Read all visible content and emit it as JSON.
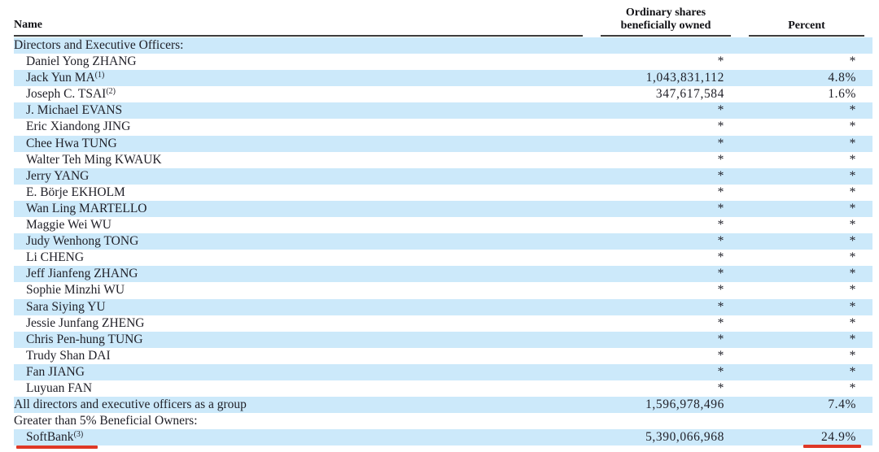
{
  "table": {
    "columns": {
      "name": "Name",
      "shares_line1": "Ordinary shares",
      "shares_line2": "beneficially owned",
      "percent": "Percent"
    },
    "rows": [
      {
        "name": "Directors and Executive Officers:",
        "footnote": "",
        "indent": 0,
        "shares": "",
        "percent": ""
      },
      {
        "name": "Daniel Yong ZHANG",
        "footnote": "",
        "indent": 1,
        "shares": "*",
        "percent": "*"
      },
      {
        "name": "Jack Yun MA",
        "footnote": "(1)",
        "indent": 1,
        "shares": "1,043,831,112",
        "percent": "4.8%"
      },
      {
        "name": "Joseph C. TSAI",
        "footnote": "(2)",
        "indent": 1,
        "shares": "347,617,584",
        "percent": "1.6%"
      },
      {
        "name": "J. Michael EVANS",
        "footnote": "",
        "indent": 1,
        "shares": "*",
        "percent": "*"
      },
      {
        "name": "Eric Xiandong JING",
        "footnote": "",
        "indent": 1,
        "shares": "*",
        "percent": "*"
      },
      {
        "name": "Chee Hwa TUNG",
        "footnote": "",
        "indent": 1,
        "shares": "*",
        "percent": "*"
      },
      {
        "name": "Walter Teh Ming KWAUK",
        "footnote": "",
        "indent": 1,
        "shares": "*",
        "percent": "*"
      },
      {
        "name": "Jerry YANG",
        "footnote": "",
        "indent": 1,
        "shares": "*",
        "percent": "*"
      },
      {
        "name": "E. Börje EKHOLM",
        "footnote": "",
        "indent": 1,
        "shares": "*",
        "percent": "*"
      },
      {
        "name": "Wan Ling MARTELLO",
        "footnote": "",
        "indent": 1,
        "shares": "*",
        "percent": "*"
      },
      {
        "name": "Maggie Wei WU",
        "footnote": "",
        "indent": 1,
        "shares": "*",
        "percent": "*"
      },
      {
        "name": "Judy Wenhong TONG",
        "footnote": "",
        "indent": 1,
        "shares": "*",
        "percent": "*"
      },
      {
        "name": "Li CHENG",
        "footnote": "",
        "indent": 1,
        "shares": "*",
        "percent": "*"
      },
      {
        "name": "Jeff Jianfeng ZHANG",
        "footnote": "",
        "indent": 1,
        "shares": "*",
        "percent": "*"
      },
      {
        "name": "Sophie Minzhi WU",
        "footnote": "",
        "indent": 1,
        "shares": "*",
        "percent": "*"
      },
      {
        "name": "Sara Siying YU",
        "footnote": "",
        "indent": 1,
        "shares": "*",
        "percent": "*"
      },
      {
        "name": "Jessie Junfang ZHENG",
        "footnote": "",
        "indent": 1,
        "shares": "*",
        "percent": "*"
      },
      {
        "name": "Chris Pen-hung TUNG",
        "footnote": "",
        "indent": 1,
        "shares": "*",
        "percent": "*"
      },
      {
        "name": "Trudy Shan DAI",
        "footnote": "",
        "indent": 1,
        "shares": "*",
        "percent": "*"
      },
      {
        "name": "Fan JIANG",
        "footnote": "",
        "indent": 1,
        "shares": "*",
        "percent": "*"
      },
      {
        "name": "Luyuan FAN",
        "footnote": "",
        "indent": 1,
        "shares": "*",
        "percent": "*"
      },
      {
        "name": "All directors and executive officers as a group",
        "footnote": "",
        "indent": 0,
        "shares": "1,596,978,496",
        "percent": "7.4%"
      },
      {
        "name": "Greater than 5% Beneficial Owners:",
        "footnote": "",
        "indent": 0,
        "shares": "",
        "percent": ""
      },
      {
        "name": "SoftBank",
        "footnote": "(3)",
        "indent": 1,
        "shares": "5,390,066,968",
        "percent": "24.9%"
      }
    ],
    "colors": {
      "row_highlight": "#cce9fa",
      "annotation_red": "#df3826"
    },
    "annotations": {
      "red_underlined_values": [
        "SoftBank(3)",
        "24.9%"
      ]
    }
  }
}
